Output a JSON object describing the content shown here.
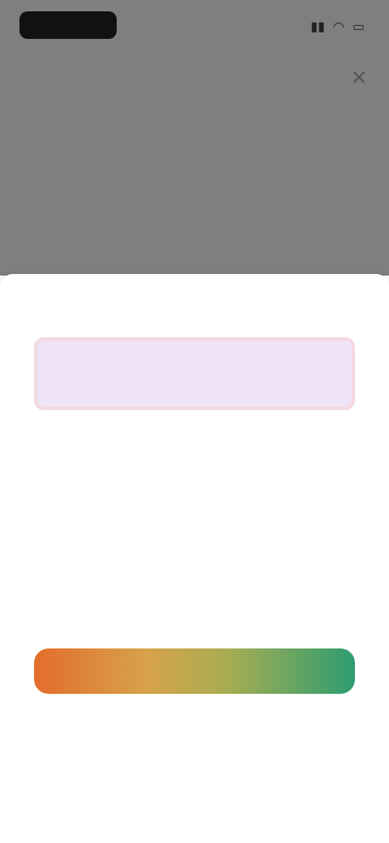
{
  "status_bar": {
    "time": "",
    "icons": [
      "signal-icon",
      "wifi-icon",
      "battery-icon"
    ]
  },
  "sheet": {
    "title": "",
    "highlight": {
      "title": "",
      "subtitle": "",
      "value": "",
      "unit": ""
    },
    "row1": {
      "title": "",
      "subtitle": "",
      "value": "",
      "unit": ""
    },
    "divider_label": "",
    "row2": {
      "title": "",
      "subtitle": "",
      "value": "",
      "unit": ""
    },
    "gradient": {
      "colors": [
        "#e36d2a",
        "#d7a24a",
        "#a8ad52",
        "#2d9d71"
      ]
    },
    "disclaimer": "",
    "footer_link": ""
  }
}
